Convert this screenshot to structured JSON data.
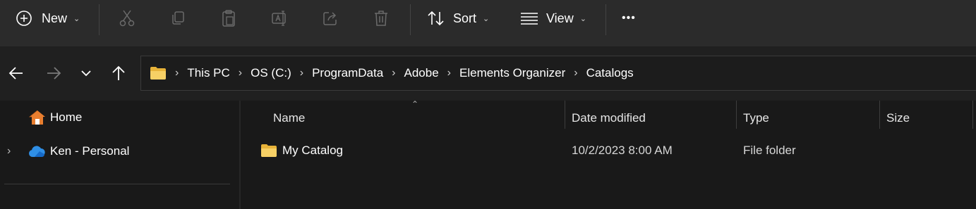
{
  "toolbar": {
    "new_label": "New",
    "sort_label": "Sort",
    "view_label": "View",
    "more_label": "•••"
  },
  "address_bar": {
    "crumbs": [
      "This PC",
      "OS (C:)",
      "ProgramData",
      "Adobe",
      "Elements Organizer",
      "Catalogs"
    ]
  },
  "sidebar": {
    "home_label": "Home",
    "onedrive_label": "Ken - Personal"
  },
  "columns": {
    "name": "Name",
    "date_modified": "Date modified",
    "type": "Type",
    "size": "Size"
  },
  "files": [
    {
      "name": "My Catalog",
      "date_modified": "10/2/2023 8:00 AM",
      "type": "File folder",
      "size": ""
    }
  ],
  "colors": {
    "toolbar_bg": "#2b2b2b",
    "window_bg": "#191919",
    "folder_yellow": "#f4c542",
    "home_orange": "#e87e2f",
    "onedrive_blue": "#2f8fe6"
  }
}
